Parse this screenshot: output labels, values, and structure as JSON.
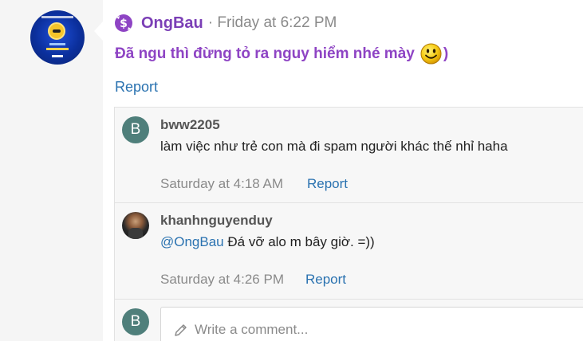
{
  "post": {
    "username": "OngBau",
    "meta": "· Friday at 6:22 PM",
    "message": "Đã ngu thì đừng tỏ ra nguy hiểm nhé mày",
    "message_suffix": ")",
    "report_label": "Report"
  },
  "comments": [
    {
      "avatar_letter": "B",
      "username": "bww2205",
      "text": "làm việc như trẻ con mà đi spam người khác thế nhỉ haha",
      "time": "Saturday at 4:18 AM",
      "report_label": "Report"
    },
    {
      "username": "khanhnguyenduy",
      "mention": "@OngBau",
      "text": " Đá vỡ alo m bây giờ. =))",
      "time": "Saturday at 4:26 PM",
      "report_label": "Report"
    }
  ],
  "composer": {
    "avatar_letter": "B",
    "placeholder": "Write a comment..."
  },
  "colors": {
    "username": "#7b3fb6",
    "message": "#8e44c4",
    "link": "#2a72b0",
    "avatar_b": "#4f7f7b"
  },
  "icons": {
    "brand": "money-icon",
    "emoji": "smiley-icon",
    "composer": "pencil-icon"
  }
}
